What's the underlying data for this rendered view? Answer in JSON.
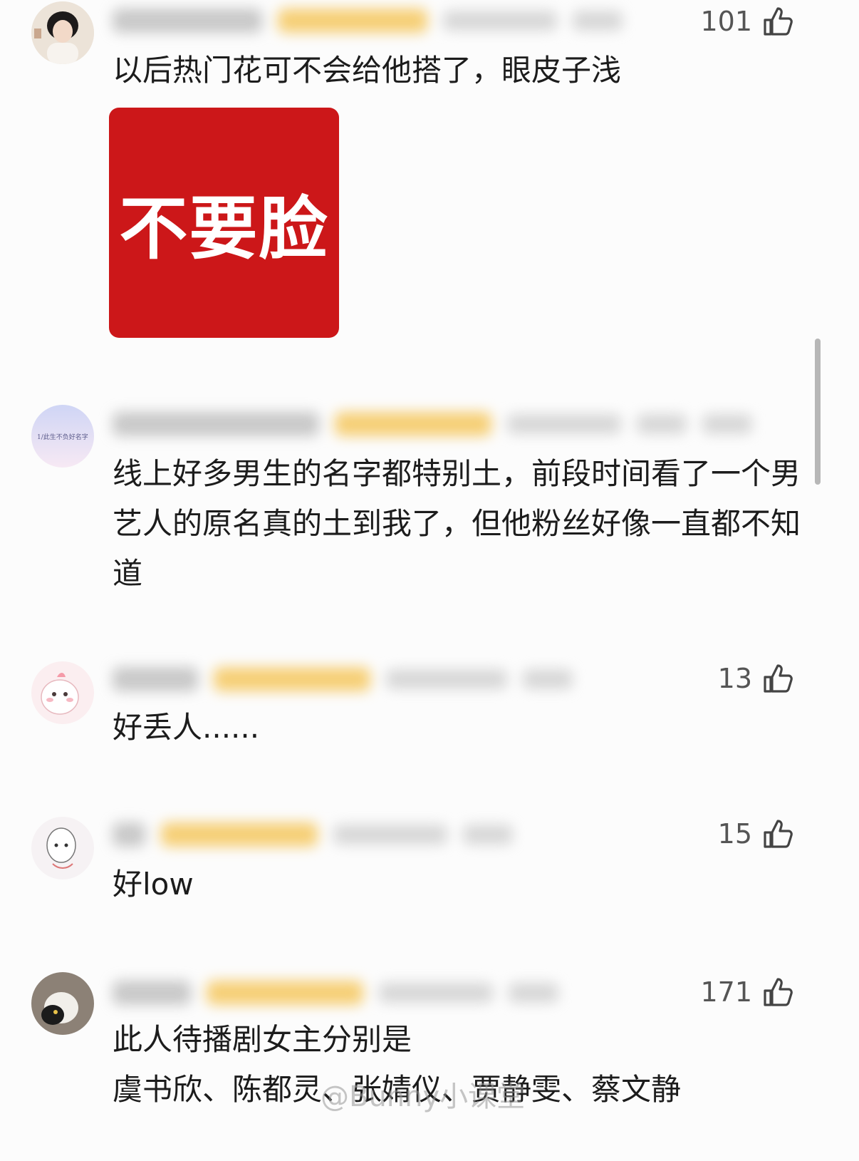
{
  "comments": [
    {
      "likes": "101",
      "text": "以后热门花可不会给他搭了，眼皮子浅",
      "sticker_text": "不要脸"
    },
    {
      "likes": "",
      "text": "线上好多男生的名字都特别土，前段时间看了一个男艺人的原名真的土到我了，但他粉丝好像一直都不知道",
      "avatar_caption": "1/此生不负好名字"
    },
    {
      "likes": "13",
      "text": "好丢人......"
    },
    {
      "likes": "15",
      "text": "好low"
    },
    {
      "likes": "171",
      "text": "此人待播剧女主分别是\n虞书欣、陈都灵、张婧仪、贾静雯、蔡文静"
    }
  ],
  "watermark": "@Bunny小课堂",
  "icons": {
    "like": "thumbs-up-icon"
  },
  "colors": {
    "sticker_bg": "#cc1719",
    "badge": "#f4c04a"
  }
}
